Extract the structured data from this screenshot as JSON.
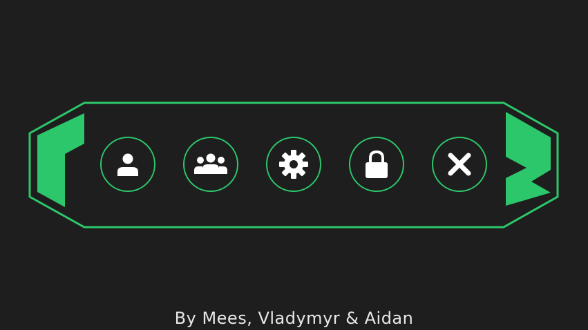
{
  "colors": {
    "background": "#1e1e1e",
    "accent": "#2dc76b",
    "icon": "#ffffff",
    "text": "#e8e8e8"
  },
  "menu": {
    "buttons": [
      {
        "id": "profile",
        "icon": "person-icon"
      },
      {
        "id": "group",
        "icon": "group-icon"
      },
      {
        "id": "settings",
        "icon": "gear-icon"
      },
      {
        "id": "lock",
        "icon": "lock-icon"
      },
      {
        "id": "close",
        "icon": "close-icon"
      }
    ]
  },
  "footer": {
    "credits": "By Mees, Vladymyr & Aidan"
  }
}
